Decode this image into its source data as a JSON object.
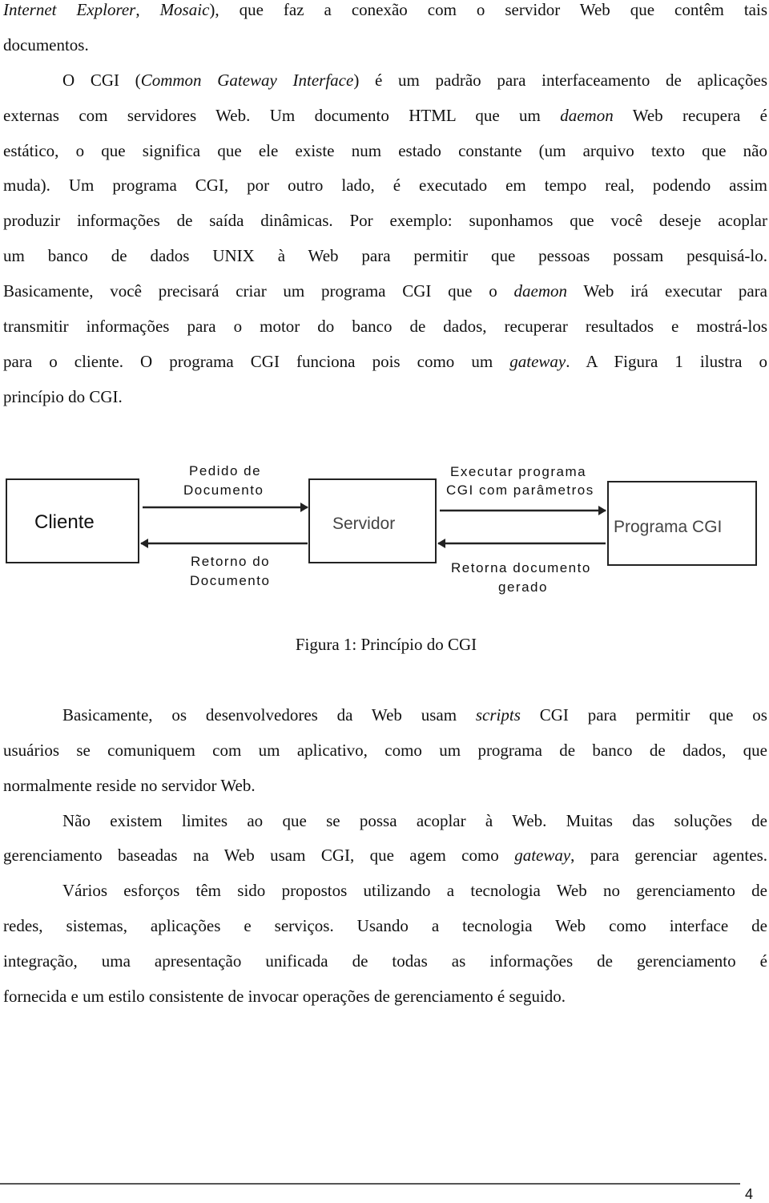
{
  "body_lines_top": [
    {
      "segments": [
        {
          "t": "Internet Explorer",
          "i": true
        },
        {
          "t": ", ",
          "i": false
        },
        {
          "t": "Mosaic",
          "i": true
        },
        {
          "t": "), que faz a conexão com o servidor Web que contêm tais",
          "i": false
        }
      ]
    },
    {
      "segments": [
        {
          "t": "documentos.",
          "i": false
        }
      ]
    },
    {
      "segments": [
        {
          "t": "O CGI (",
          "i": false
        },
        {
          "t": "Common Gateway Interface",
          "i": true
        },
        {
          "t": ") é um padrão para interfaceamento de aplicações",
          "i": false
        }
      ]
    },
    {
      "segments": [
        {
          "t": "externas com servidores Web. Um documento HTML que um ",
          "i": false
        },
        {
          "t": "daemon",
          "i": true
        },
        {
          "t": " Web recupera é",
          "i": false
        }
      ]
    },
    {
      "segments": [
        {
          "t": "estático, o que significa que ele existe num estado constante (um arquivo texto que não",
          "i": false
        }
      ]
    },
    {
      "segments": [
        {
          "t": "muda). Um programa CGI, por outro lado, é executado em tempo real, podendo assim",
          "i": false
        }
      ]
    },
    {
      "segments": [
        {
          "t": "produzir informações de saída dinâmicas. Por exemplo: suponhamos que você deseje acoplar",
          "i": false
        }
      ]
    },
    {
      "segments": [
        {
          "t": "um banco de dados UNIX à Web para permitir que pessoas possam pesquisá-lo.",
          "i": false
        }
      ]
    },
    {
      "segments": [
        {
          "t": "Basicamente, você precisará criar um programa CGI que o ",
          "i": false
        },
        {
          "t": "daemon",
          "i": true
        },
        {
          "t": " Web irá executar para",
          "i": false
        }
      ]
    },
    {
      "segments": [
        {
          "t": "transmitir informações para o motor do banco de dados, recuperar resultados e mostrá-los",
          "i": false
        }
      ]
    },
    {
      "segments": [
        {
          "t": "para o cliente. O programa CGI funciona pois como um ",
          "i": false
        },
        {
          "t": "gateway",
          "i": true
        },
        {
          "t": ". A Figura 1 ilustra  o",
          "i": false
        }
      ]
    },
    {
      "segments": [
        {
          "t": "princípio do CGI.",
          "i": false
        }
      ]
    }
  ],
  "diagram": {
    "boxes": {
      "client": "Cliente",
      "server": "Servidor",
      "cgi": "Programa CGI"
    },
    "labels": {
      "request_1": "Pedido de",
      "request_2": "Documento",
      "return_1": "Retorno do",
      "return_2": "Documento",
      "exec_1": "Executar programa",
      "exec_2": "CGI com parâmetros",
      "gen_1": "Retorna documento",
      "gen_2": "gerado"
    }
  },
  "caption": "Figura 1: Princípio do CGI",
  "body_lines_bottom": [
    {
      "segments": [
        {
          "t": "Basicamente, os desenvolvedores da Web usam ",
          "i": false
        },
        {
          "t": "scripts",
          "i": true
        },
        {
          "t": " CGI para permitir que os",
          "i": false
        }
      ]
    },
    {
      "segments": [
        {
          "t": "usuários se comuniquem com um aplicativo, como um programa de banco de dados, que",
          "i": false
        }
      ]
    },
    {
      "segments": [
        {
          "t": "normalmente reside no servidor Web.",
          "i": false
        }
      ]
    },
    {
      "segments": [
        {
          "t": "Não existem limites ao que se possa acoplar à Web. Muitas das soluções de",
          "i": false
        }
      ]
    },
    {
      "segments": [
        {
          "t": "gerenciamento baseadas na Web usam CGI, que agem como ",
          "i": false
        },
        {
          "t": "gateway",
          "i": true
        },
        {
          "t": ", para gerenciar agentes.",
          "i": false
        }
      ]
    },
    {
      "segments": [
        {
          "t": "Vários esforços têm sido propostos utilizando a tecnologia Web no gerenciamento de",
          "i": false
        }
      ]
    },
    {
      "segments": [
        {
          "t": "redes, sistemas, aplicações e serviços. Usando a tecnologia Web como interface de",
          "i": false
        }
      ]
    },
    {
      "segments": [
        {
          "t": "integração, uma apresentação unificada de todas as informações de gerenciamento é",
          "i": false
        }
      ]
    },
    {
      "segments": [
        {
          "t": "fornecida e um estilo consistente de invocar operações de gerenciamento é seguido.",
          "i": false
        }
      ]
    }
  ],
  "page_number": "4"
}
